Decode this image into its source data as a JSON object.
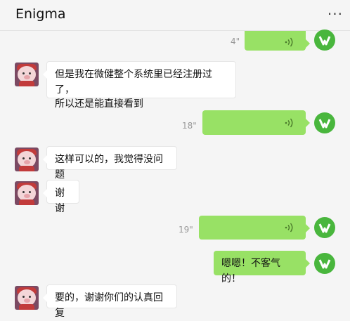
{
  "header": {
    "title": "Enigma",
    "more_icon": "more-dots-icon",
    "more_label": "···"
  },
  "messages": [
    {
      "side": "right",
      "type": "voice",
      "duration": "4\""
    },
    {
      "side": "left",
      "type": "text",
      "line1": "但是我在微健整个系统里已经注册过了，",
      "line2": "所以还是能直接看到"
    },
    {
      "side": "right",
      "type": "voice",
      "duration": "18\""
    },
    {
      "side": "left",
      "type": "text",
      "text": "这样可以的，我觉得没问题"
    },
    {
      "side": "left",
      "type": "text",
      "text": "谢谢"
    },
    {
      "side": "right",
      "type": "voice",
      "duration": "19\""
    },
    {
      "side": "right",
      "type": "text",
      "text": "嗯嗯！不客气的！"
    },
    {
      "side": "left",
      "type": "text",
      "text": "要的，谢谢你们的认真回复"
    }
  ],
  "colors": {
    "my_bubble": "#98e165",
    "their_bubble": "#ffffff",
    "my_avatar": "#49b63d",
    "background": "#f5f5f5"
  }
}
